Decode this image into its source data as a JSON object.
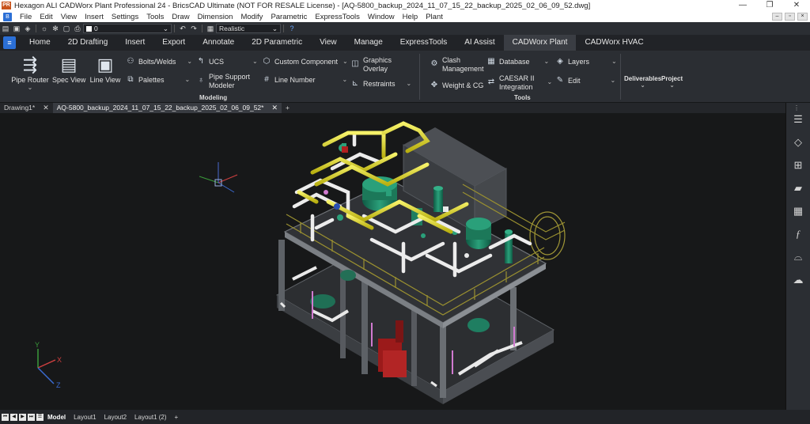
{
  "window": {
    "title": "Hexagon ALI CADWorx Plant Professional 24 - BricsCAD Ultimate (NOT FOR RESALE License) - [AQ-5800_backup_2024_11_07_15_22_backup_2025_02_06_09_52.dwg]",
    "app_badge": "PR",
    "minimize": "—",
    "restore": "❐",
    "close": "✕"
  },
  "menu": {
    "items": [
      "File",
      "Edit",
      "View",
      "Insert",
      "Settings",
      "Tools",
      "Draw",
      "Dimension",
      "Modify",
      "Parametric",
      "ExpressTools",
      "Window",
      "Help",
      "Plant"
    ]
  },
  "qat": {
    "layer_value": "0",
    "visual_style": "Realistic"
  },
  "ribbon_tabs": [
    "Home",
    "2D Drafting",
    "Insert",
    "Export",
    "Annotate",
    "2D Parametric",
    "View",
    "Manage",
    "ExpressTools",
    "AI Assist",
    "CADWorx Plant",
    "CADWorx HVAC"
  ],
  "active_tab": "CADWorx Plant",
  "ribbon": {
    "pipe_router": "Pipe Router",
    "spec_view": "Spec View",
    "line_view": "Line View",
    "bolts_welds": "Bolts/Welds",
    "palettes": "Palettes",
    "ucs": "UCS",
    "pipe_support_1": "Pipe Support",
    "pipe_support_2": "Modeler",
    "custom_component": "Custom Component",
    "line_number": "Line Number",
    "graphics_overlay_1": "Graphics",
    "graphics_overlay_2": "Overlay",
    "restraints": "Restraints",
    "clash_1": "Clash",
    "clash_2": "Management",
    "weight_cg": "Weight & CG",
    "database": "Database",
    "caesar_1": "CAESAR II",
    "caesar_2": "Integration",
    "layers": "Layers",
    "edit": "Edit",
    "deliverables": "Deliverables",
    "project": "Project",
    "group_modeling": "Modeling",
    "group_tools": "Tools"
  },
  "doc_tabs": [
    {
      "label": "Drawing1*"
    },
    {
      "label": "AQ-5800_backup_2024_11_07_15_22_backup_2025_02_06_09_52*"
    }
  ],
  "ucs": {
    "x": "X",
    "y": "Y",
    "z": "Z"
  },
  "layout_tabs": [
    "Model",
    "Layout1",
    "Layout2",
    "Layout1 (2)"
  ],
  "add_tab": "+",
  "colors": {
    "pipe_yellow": "#e8e21a",
    "pipe_white": "#e9e9e9",
    "equipment_green": "#1f7e61",
    "structure_gray": "#6f7378",
    "handrail_olive": "#9a9030",
    "vessel_red": "#a11c1c",
    "support_magenta": "#d07ad0"
  }
}
